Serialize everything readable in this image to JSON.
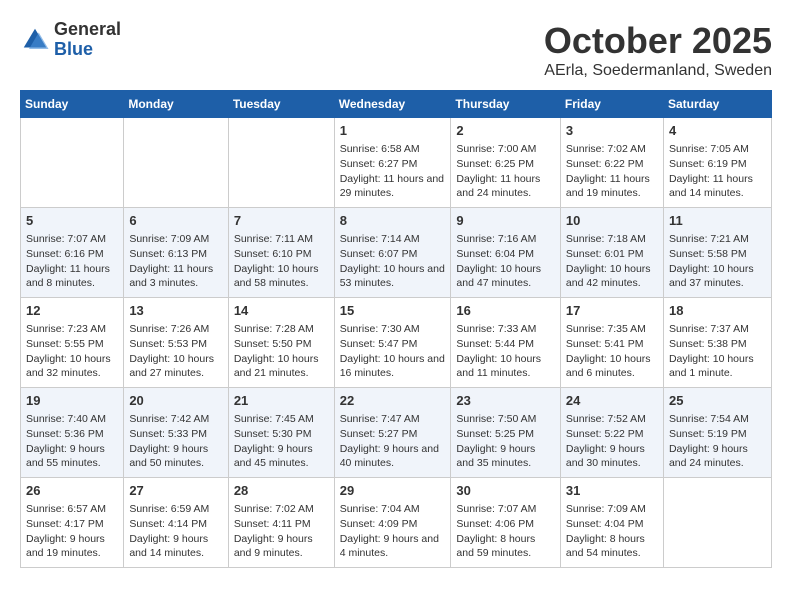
{
  "logo": {
    "general": "General",
    "blue": "Blue"
  },
  "title": "October 2025",
  "subtitle": "AErla, Soedermanland, Sweden",
  "days_of_week": [
    "Sunday",
    "Monday",
    "Tuesday",
    "Wednesday",
    "Thursday",
    "Friday",
    "Saturday"
  ],
  "weeks": [
    [
      {
        "day": "",
        "info": ""
      },
      {
        "day": "",
        "info": ""
      },
      {
        "day": "",
        "info": ""
      },
      {
        "day": "1",
        "info": "Sunrise: 6:58 AM\nSunset: 6:27 PM\nDaylight: 11 hours and 29 minutes."
      },
      {
        "day": "2",
        "info": "Sunrise: 7:00 AM\nSunset: 6:25 PM\nDaylight: 11 hours and 24 minutes."
      },
      {
        "day": "3",
        "info": "Sunrise: 7:02 AM\nSunset: 6:22 PM\nDaylight: 11 hours and 19 minutes."
      },
      {
        "day": "4",
        "info": "Sunrise: 7:05 AM\nSunset: 6:19 PM\nDaylight: 11 hours and 14 minutes."
      }
    ],
    [
      {
        "day": "5",
        "info": "Sunrise: 7:07 AM\nSunset: 6:16 PM\nDaylight: 11 hours and 8 minutes."
      },
      {
        "day": "6",
        "info": "Sunrise: 7:09 AM\nSunset: 6:13 PM\nDaylight: 11 hours and 3 minutes."
      },
      {
        "day": "7",
        "info": "Sunrise: 7:11 AM\nSunset: 6:10 PM\nDaylight: 10 hours and 58 minutes."
      },
      {
        "day": "8",
        "info": "Sunrise: 7:14 AM\nSunset: 6:07 PM\nDaylight: 10 hours and 53 minutes."
      },
      {
        "day": "9",
        "info": "Sunrise: 7:16 AM\nSunset: 6:04 PM\nDaylight: 10 hours and 47 minutes."
      },
      {
        "day": "10",
        "info": "Sunrise: 7:18 AM\nSunset: 6:01 PM\nDaylight: 10 hours and 42 minutes."
      },
      {
        "day": "11",
        "info": "Sunrise: 7:21 AM\nSunset: 5:58 PM\nDaylight: 10 hours and 37 minutes."
      }
    ],
    [
      {
        "day": "12",
        "info": "Sunrise: 7:23 AM\nSunset: 5:55 PM\nDaylight: 10 hours and 32 minutes."
      },
      {
        "day": "13",
        "info": "Sunrise: 7:26 AM\nSunset: 5:53 PM\nDaylight: 10 hours and 27 minutes."
      },
      {
        "day": "14",
        "info": "Sunrise: 7:28 AM\nSunset: 5:50 PM\nDaylight: 10 hours and 21 minutes."
      },
      {
        "day": "15",
        "info": "Sunrise: 7:30 AM\nSunset: 5:47 PM\nDaylight: 10 hours and 16 minutes."
      },
      {
        "day": "16",
        "info": "Sunrise: 7:33 AM\nSunset: 5:44 PM\nDaylight: 10 hours and 11 minutes."
      },
      {
        "day": "17",
        "info": "Sunrise: 7:35 AM\nSunset: 5:41 PM\nDaylight: 10 hours and 6 minutes."
      },
      {
        "day": "18",
        "info": "Sunrise: 7:37 AM\nSunset: 5:38 PM\nDaylight: 10 hours and 1 minute."
      }
    ],
    [
      {
        "day": "19",
        "info": "Sunrise: 7:40 AM\nSunset: 5:36 PM\nDaylight: 9 hours and 55 minutes."
      },
      {
        "day": "20",
        "info": "Sunrise: 7:42 AM\nSunset: 5:33 PM\nDaylight: 9 hours and 50 minutes."
      },
      {
        "day": "21",
        "info": "Sunrise: 7:45 AM\nSunset: 5:30 PM\nDaylight: 9 hours and 45 minutes."
      },
      {
        "day": "22",
        "info": "Sunrise: 7:47 AM\nSunset: 5:27 PM\nDaylight: 9 hours and 40 minutes."
      },
      {
        "day": "23",
        "info": "Sunrise: 7:50 AM\nSunset: 5:25 PM\nDaylight: 9 hours and 35 minutes."
      },
      {
        "day": "24",
        "info": "Sunrise: 7:52 AM\nSunset: 5:22 PM\nDaylight: 9 hours and 30 minutes."
      },
      {
        "day": "25",
        "info": "Sunrise: 7:54 AM\nSunset: 5:19 PM\nDaylight: 9 hours and 24 minutes."
      }
    ],
    [
      {
        "day": "26",
        "info": "Sunrise: 6:57 AM\nSunset: 4:17 PM\nDaylight: 9 hours and 19 minutes."
      },
      {
        "day": "27",
        "info": "Sunrise: 6:59 AM\nSunset: 4:14 PM\nDaylight: 9 hours and 14 minutes."
      },
      {
        "day": "28",
        "info": "Sunrise: 7:02 AM\nSunset: 4:11 PM\nDaylight: 9 hours and 9 minutes."
      },
      {
        "day": "29",
        "info": "Sunrise: 7:04 AM\nSunset: 4:09 PM\nDaylight: 9 hours and 4 minutes."
      },
      {
        "day": "30",
        "info": "Sunrise: 7:07 AM\nSunset: 4:06 PM\nDaylight: 8 hours and 59 minutes."
      },
      {
        "day": "31",
        "info": "Sunrise: 7:09 AM\nSunset: 4:04 PM\nDaylight: 8 hours and 54 minutes."
      },
      {
        "day": "",
        "info": ""
      }
    ]
  ]
}
